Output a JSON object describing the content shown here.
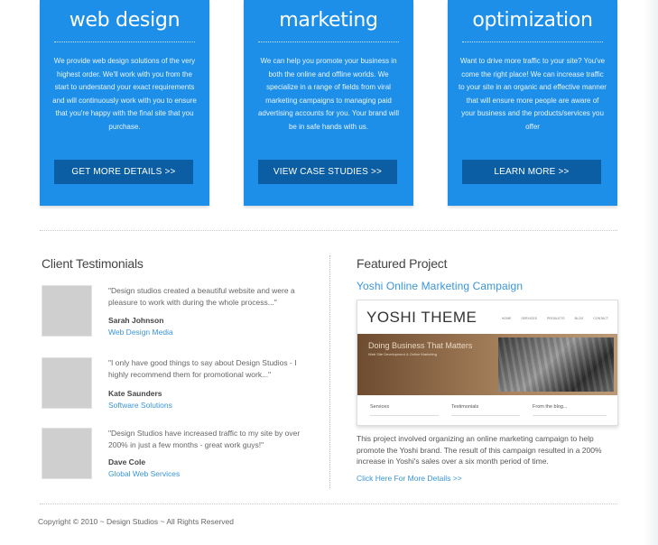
{
  "services": [
    {
      "title": "web design",
      "description": "We provide web design solutions of the very highest order. We'll work with you from the start to understand your exact requirements and will continuously work with you to ensure that you're happy with the final site that you purchase.",
      "button": "GET MORE DETAILS >>"
    },
    {
      "title": "marketing",
      "description": "We can help you promote your business in both the online and offline worlds. We specialize in a range of fields from viral marketing campaigns to managing paid advertising accounts for you. Your brand will be in safe hands with us.",
      "button": "VIEW CASE STUDIES >>"
    },
    {
      "title": "optimization",
      "description": "Want to drive more traffic to your site? You've come the right place! We can increase traffic to your site in an organic and effective manner that will ensure more people are aware of your business and the products/services you offer",
      "button": "LEARN MORE >>"
    }
  ],
  "testimonials": {
    "heading": "Client Testimonials",
    "items": [
      {
        "quote": "\"Design studios created a beautiful website and were a pleasure to work with during the whole process...\"",
        "name": "Sarah Johnson",
        "company": "Web Design Media"
      },
      {
        "quote": "\"I only have good things to say about Design Studios - I highly recommend them for promotional work...\"",
        "name": "Kate Saunders",
        "company": "Software Solutions"
      },
      {
        "quote": "\"Design Studios have increased traffic to my site by over 200% in just a few months - great work guys!\"",
        "name": "Dave Cole",
        "company": "Global Web Services"
      }
    ]
  },
  "featured": {
    "heading": "Featured Project",
    "project_name": "Yoshi Online Marketing Campaign",
    "preview": {
      "logo": "YOSHI THEME",
      "nav": [
        "HOME",
        "SERVICES",
        "PRODUCTS",
        "BLOG",
        "CONTACT"
      ],
      "banner_heading": "Doing Business That Matters",
      "banner_sub": "Web Site Development & Online Marketing",
      "col1": "Services",
      "col2": "Testimonials",
      "col3": "From the blog..."
    },
    "description": "This project involved organizing an online marketing campaign to help promote the Yoshi brand. The result of this campaign resulted in a 200% increase in Yoshi's sales over a six month period of time.",
    "link": "Click Here For More Details >>"
  },
  "footer": {
    "copyright": "Copyright © 2010 ~ Design Studios ~ All Rights Reserved"
  },
  "colors": {
    "service_blue": "#1d8fe8",
    "button_blue": "#0b5ea3",
    "link_blue": "#3b95d9"
  }
}
